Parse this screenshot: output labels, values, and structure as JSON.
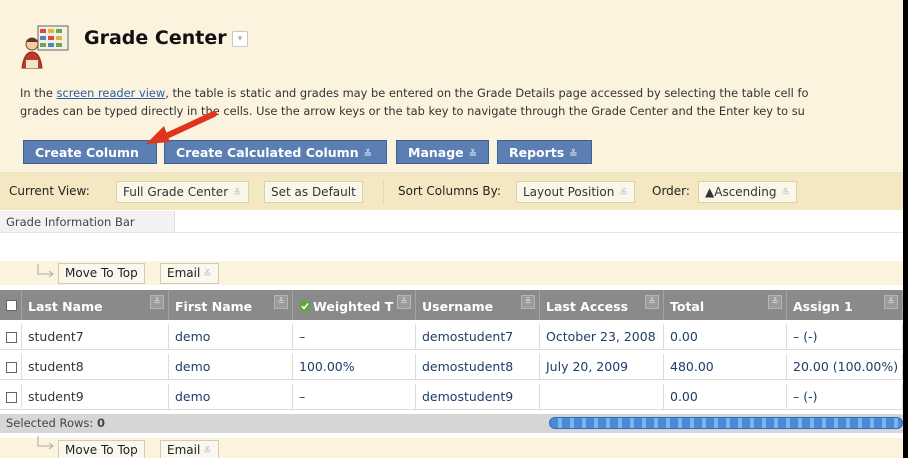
{
  "header": {
    "title": "Grade Center",
    "intro_line1_before": "In the ",
    "intro_link": "screen reader view",
    "intro_line1_after": ", the table is static and grades may be entered on the Grade Details page accessed by selecting the table cell fo",
    "intro_line2": "grades can be typed directly in the cells. Use the arrow keys or the tab key to navigate through the Grade Center and the Enter key to su"
  },
  "actions": {
    "create_column": "Create Column",
    "create_calculated_column": "Create Calculated Column",
    "manage": "Manage",
    "reports": "Reports"
  },
  "view_bar": {
    "current_view_label": "Current View:",
    "current_view_value": "Full Grade Center",
    "set_default": "Set as Default",
    "sort_label": "Sort Columns By:",
    "sort_value": "Layout Position",
    "order_label": "Order:",
    "order_value": "▲Ascending"
  },
  "info_bar": {
    "label": "Grade Information Bar"
  },
  "toolbar": {
    "move_to_top": "Move To Top",
    "email": "Email"
  },
  "table": {
    "columns": [
      "Last Name",
      "First Name",
      "Weighted T",
      "Username",
      "Last Access",
      "Total",
      "Assign 1"
    ],
    "rows": [
      [
        "student7",
        "demo",
        "–",
        "demostudent7",
        "October 23, 2008",
        "0.00",
        "– (-)"
      ],
      [
        "student8",
        "demo",
        "100.00%",
        "demostudent8",
        "July 20, 2009",
        "480.00",
        "20.00 (100.00%)"
      ],
      [
        "student9",
        "demo",
        "–",
        "demostudent9",
        "",
        "0.00",
        "– (-)"
      ]
    ]
  },
  "selection": {
    "label": "Selected Rows:",
    "count": "0"
  },
  "icons": [
    "grade-center-logo-icon",
    "red-arrow-icon",
    "chevron-down-icon",
    "checkbox-icon",
    "weighted-check-icon",
    "indent-arrow-icon",
    "column-menu-icon"
  ],
  "colors": {
    "header_bg": "#fbf3dd",
    "button_blue": "#5b7fb3",
    "grid_header": "#8a8a8a",
    "link": "#1f3d66",
    "arrow_red": "#e0341c"
  }
}
